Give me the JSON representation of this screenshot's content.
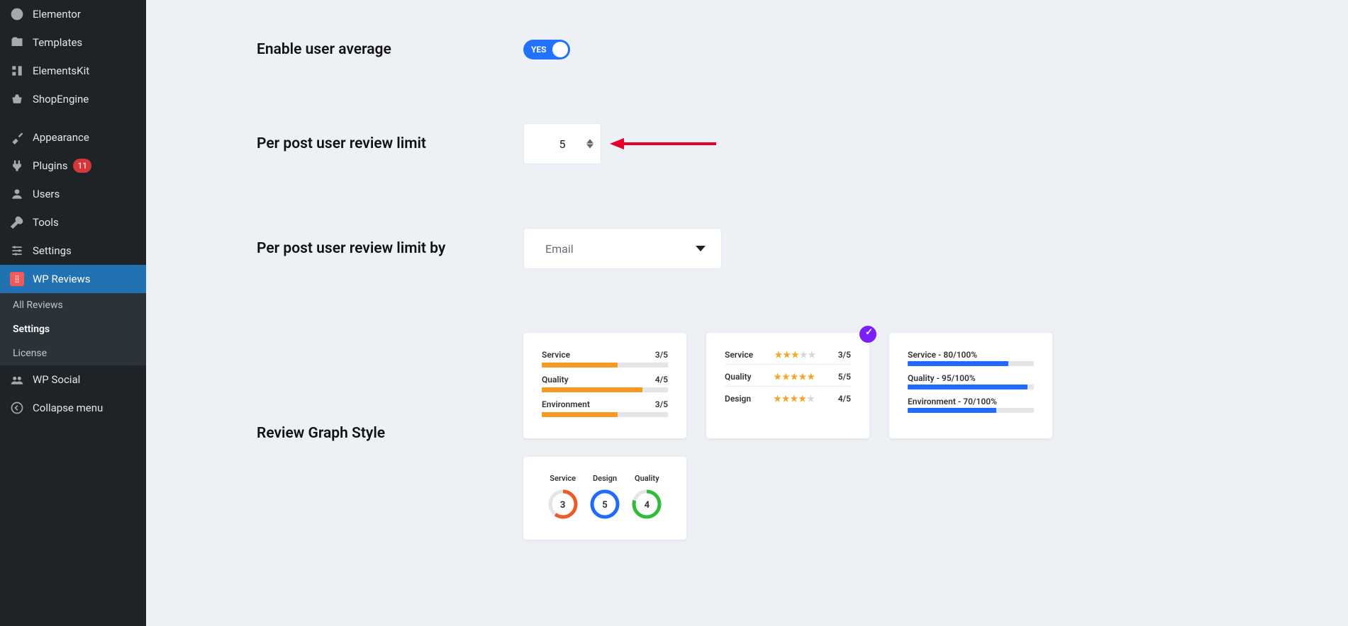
{
  "sidebar": {
    "items": [
      {
        "label": "Elementor"
      },
      {
        "label": "Templates"
      },
      {
        "label": "ElementsKit"
      },
      {
        "label": "ShopEngine"
      },
      {
        "label": "Appearance"
      },
      {
        "label": "Plugins",
        "badge": "11"
      },
      {
        "label": "Users"
      },
      {
        "label": "Tools"
      },
      {
        "label": "Settings"
      },
      {
        "label": "WP Reviews",
        "active": true
      },
      {
        "label": "WP Social"
      },
      {
        "label": "Collapse menu"
      }
    ],
    "submenu": {
      "items": [
        {
          "label": "All Reviews"
        },
        {
          "label": "Settings",
          "selected": true
        },
        {
          "label": "License"
        }
      ]
    }
  },
  "settings": {
    "enable_user_average": {
      "label": "Enable user average",
      "toggle_text": "YES"
    },
    "review_limit": {
      "label": "Per post user review limit",
      "value": "5"
    },
    "review_limit_by": {
      "label": "Per post user review limit by",
      "value": "Email"
    },
    "graph_style": {
      "label": "Review Graph Style"
    }
  },
  "graph_cards": [
    {
      "type": "bars_orange",
      "rows": [
        {
          "label": "Service",
          "score": "3/5",
          "pct": 60
        },
        {
          "label": "Quality",
          "score": "4/5",
          "pct": 80
        },
        {
          "label": "Environment",
          "score": "3/5",
          "pct": 60
        }
      ]
    },
    {
      "type": "stars",
      "selected": true,
      "rows": [
        {
          "label": "Service",
          "stars": 3,
          "score": "3/5"
        },
        {
          "label": "Quality",
          "stars": 5,
          "score": "5/5"
        },
        {
          "label": "Design",
          "stars": 4,
          "score": "4/5"
        }
      ]
    },
    {
      "type": "bars_blue",
      "rows": [
        {
          "label": "Service - 80/100%",
          "pct": 80
        },
        {
          "label": "Quality - 95/100%",
          "pct": 95
        },
        {
          "label": "Environment - 70/100%",
          "pct": 70
        }
      ]
    },
    {
      "type": "gauges",
      "items": [
        {
          "label": "Service",
          "value": "3",
          "color": "#f05a28",
          "frac": 0.6
        },
        {
          "label": "Design",
          "value": "5",
          "color": "#1f6bff",
          "frac": 1.0
        },
        {
          "label": "Quality",
          "value": "4",
          "color": "#2dbd3a",
          "frac": 0.8
        }
      ]
    }
  ]
}
